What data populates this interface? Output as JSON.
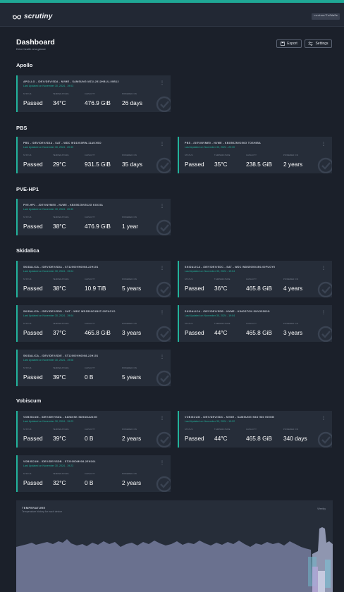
{
  "app": {
    "name": "scrutiny",
    "badge": "custom/TofWaSe"
  },
  "page": {
    "title": "Dashboard",
    "subtitle": "Drive health at a glance"
  },
  "actions": {
    "export_label": "Export",
    "settings_label": "Settings"
  },
  "labels": {
    "status": "STATUS",
    "temperature": "TEMPERATURE",
    "capacity": "CAPACITY",
    "powered_on": "POWERED ON"
  },
  "groups": [
    {
      "name": "Apollo",
      "cards": [
        {
          "title": "APOLLO - /DEV/DEV/SDA - NVME - SAMSUNG MZ1L2512HBLU-00B12",
          "updated": "Last Updated on November 30, 2024 - 19:03",
          "status": "Passed",
          "temp": "34°C",
          "capacity": "476.9 GiB",
          "powered_on": "26 days"
        }
      ]
    },
    {
      "name": "PBS",
      "cards": [
        {
          "title": "PBS - /DEV/DEV/SDA - SAT - WDC WD10S0RW-11AKXSO",
          "updated": "Last Updated on November 30, 2024 - 20:30",
          "status": "Passed",
          "temp": "29°C",
          "capacity": "931.5 GiB",
          "powered_on": "35 days"
        },
        {
          "title": "PBS - /DEV/NVME0 - NVME - KBG50ZNV256G TOSHIBA",
          "updated": "Last Updated on November 30, 2024 - 20:30",
          "status": "Passed",
          "temp": "35°C",
          "capacity": "238.5 GiB",
          "powered_on": "2 years"
        }
      ]
    },
    {
      "name": "PVE-HP1",
      "cards": [
        {
          "title": "PVE-HP1 - /DEV/NVME0 - NVME - KBG50ZNV512G KIOXIA",
          "updated": "Last Updated on November 30, 2024 - 20:30",
          "status": "Passed",
          "temp": "38°C",
          "capacity": "476.9 GiB",
          "powered_on": "1 year"
        }
      ]
    },
    {
      "name": "Skidalica",
      "cards": [
        {
          "title": "SKIDALICA - /DEV/DEV/SDA - ST12000VN0008-2JH101",
          "updated": "Last Updated on November 30, 2024 - 19:04",
          "status": "Passed",
          "temp": "38°C",
          "capacity": "10.9 TiB",
          "powered_on": "5 years"
        },
        {
          "title": "SKIDALICA - /DEV/DEV/SDC - SAT - WDC WDS500G1B0-00FUOY0",
          "updated": "Last Updated on November 30, 2024 - 19:04",
          "status": "Passed",
          "temp": "36°C",
          "capacity": "465.8 GiB",
          "powered_on": "4 years"
        },
        {
          "title": "SKIDALICA - /DEV/DEV/SDD - SAT - WDC WDS500G1B0T-00FUOY0",
          "updated": "Last Updated on November 30, 2024 - 19:04",
          "status": "Passed",
          "temp": "37°C",
          "capacity": "465.8 GiB",
          "powered_on": "3 years"
        },
        {
          "title": "SKIDALICA - /DEV/DEV/SDB - NVME - KINGSTON SNV3S500G",
          "updated": "Last Updated on November 30, 2024 - 19:04",
          "status": "Passed",
          "temp": "44°C",
          "capacity": "465.8 GiB",
          "powered_on": "3 years"
        },
        {
          "title": "SKIDALICA - /DEV/DEV/SDE - ST12000VN0008-2JH101",
          "updated": "Last Updated on November 30, 2024 - 19:08",
          "status": "Passed",
          "temp": "39°C",
          "capacity": "0 B",
          "powered_on": "5 years"
        }
      ]
    },
    {
      "name": "Vobiscum",
      "cards": [
        {
          "title": "VOBISCUM - /DEV/DEV/SDA - SANDISK SDSSDA240G",
          "updated": "Last Updated on November 30, 2024 - 19:23",
          "status": "Passed",
          "temp": "39°C",
          "capacity": "0 B",
          "powered_on": "2 years"
        },
        {
          "title": "VOBISCUM - /DEV/DEV/SDC - NVME - SAMSUNG SSD 980 500GB",
          "updated": "Last Updated on November 30, 2024 - 19:22",
          "status": "Passed",
          "temp": "44°C",
          "capacity": "465.8 GiB",
          "powered_on": "340 days"
        },
        {
          "title": "VOBISCUM - /DEV/DEV/SDB - ST2000DM008-2EN164",
          "updated": "Last Updated on November 30, 2024 - 19:23",
          "status": "Passed",
          "temp": "32°C",
          "capacity": "0 B",
          "powered_on": "2 years"
        }
      ]
    }
  ],
  "temperature_panel": {
    "title": "TEMPERATURE",
    "subtitle": "Temperature history for each device",
    "range_label": "Weekly"
  },
  "colors": {
    "accent": "#22b39c",
    "card_bg": "#262d39",
    "page_bg": "#1b202a",
    "chart_area": "#6e7594"
  }
}
